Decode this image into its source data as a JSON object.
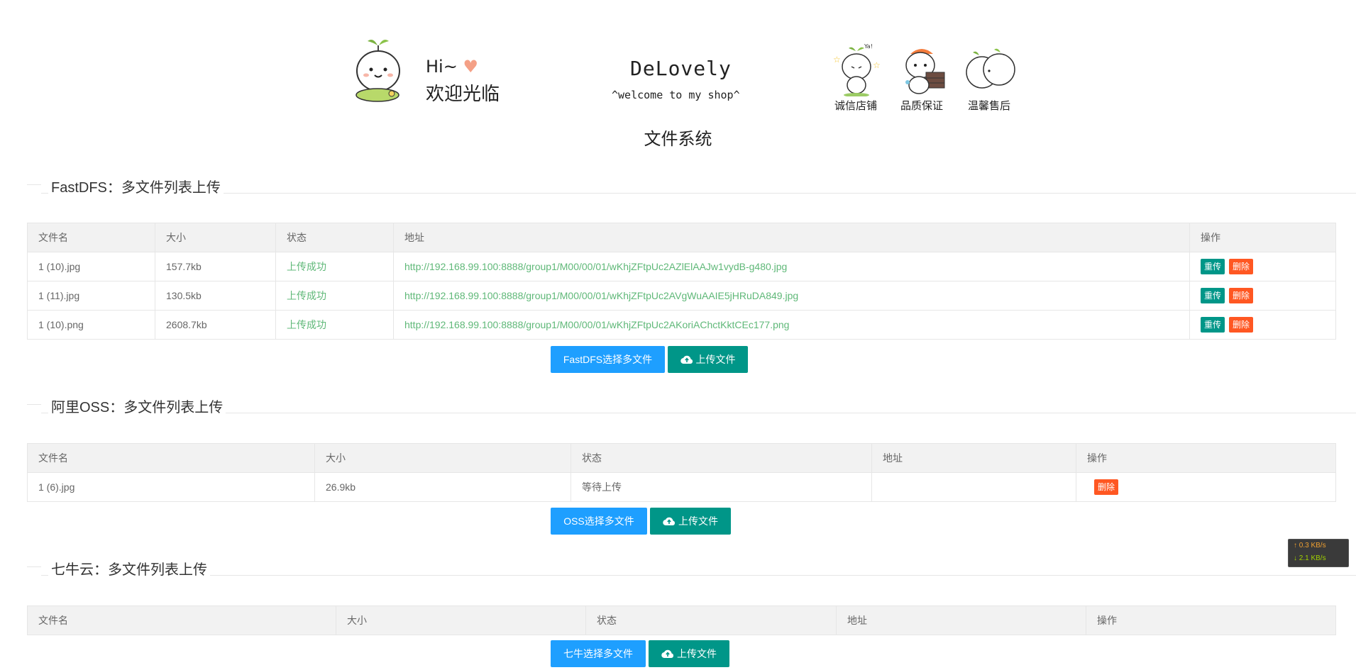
{
  "banner": {
    "hi": "Hi~",
    "welcome_cn": "欢迎光临",
    "brand": "DeLovely",
    "welcome_en": "^welcome to my shop^",
    "badges": [
      "诚信店铺",
      "品质保证",
      "温馨售后"
    ],
    "badge_note": "Ya!"
  },
  "page_title": "文件系统",
  "sections": [
    {
      "title": "FastDFS：多文件列表上传",
      "headers": [
        "文件名",
        "大小",
        "状态",
        "地址",
        "操作"
      ],
      "rows": [
        {
          "name": "1 (10).jpg",
          "size": "157.7kb",
          "status": "上传成功",
          "url": "http://192.168.99.100:8888/group1/M00/00/01/wKhjZFtpUc2AZlElAAJw1vydB-g480.jpg",
          "actions": [
            "重传",
            "删除"
          ]
        },
        {
          "name": "1 (11).jpg",
          "size": "130.5kb",
          "status": "上传成功",
          "url": "http://192.168.99.100:8888/group1/M00/00/01/wKhjZFtpUc2AVgWuAAIE5jHRuDA849.jpg",
          "actions": [
            "重传",
            "删除"
          ]
        },
        {
          "name": "1 (10).png",
          "size": "2608.7kb",
          "status": "上传成功",
          "url": "http://192.168.99.100:8888/group1/M00/00/01/wKhjZFtpUc2AKoriAChctKktCEc177.png",
          "actions": [
            "重传",
            "删除"
          ]
        }
      ],
      "select_label": "FastDFS选择多文件",
      "upload_label": "上传文件"
    },
    {
      "title": "阿里OSS：多文件列表上传",
      "headers": [
        "文件名",
        "大小",
        "状态",
        "地址",
        "操作"
      ],
      "rows": [
        {
          "name": "1 (6).jpg",
          "size": "26.9kb",
          "status": "等待上传",
          "url": "",
          "actions": [
            "删除"
          ]
        }
      ],
      "select_label": "OSS选择多文件",
      "upload_label": "上传文件"
    },
    {
      "title": "七牛云：多文件列表上传",
      "headers": [
        "文件名",
        "大小",
        "状态",
        "地址",
        "操作"
      ],
      "rows": [],
      "select_label": "七牛选择多文件",
      "upload_label": "上传文件"
    }
  ],
  "speed": {
    "up": "↑ 0.3 KB/s",
    "down": "↓ 2.1 KB/s"
  },
  "colors": {
    "primary_blue": "#1e9fff",
    "teal": "#009688",
    "danger": "#ff5722",
    "success_text": "#5fb878"
  }
}
